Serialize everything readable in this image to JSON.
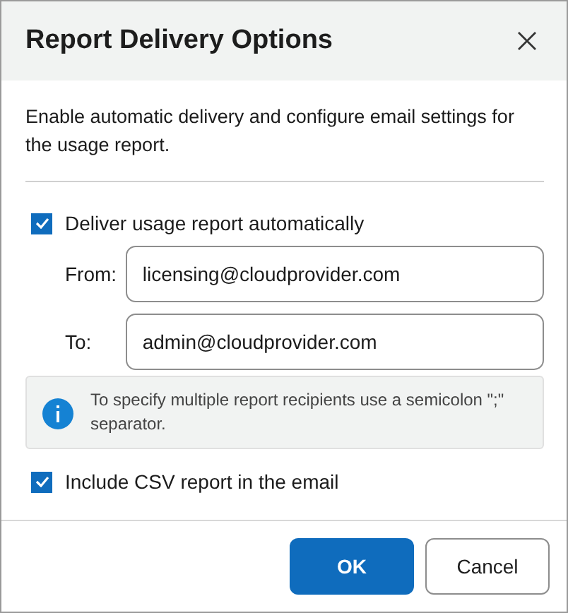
{
  "dialog": {
    "title": "Report Delivery Options"
  },
  "description": "Enable automatic delivery and configure email settings for the usage report.",
  "deliver_checkbox": {
    "label": "Deliver usage report automatically",
    "checked": true
  },
  "fields": [
    {
      "label": "From:",
      "value": "licensing@cloudprovider.com"
    },
    {
      "label": "To:",
      "value": "admin@cloudprovider.com"
    }
  ],
  "info": {
    "text": "To specify multiple report recipients use a semicolon \";\" separator."
  },
  "csv_checkbox": {
    "label": "Include CSV report in the email",
    "checked": true
  },
  "buttons": [
    {
      "label": "OK",
      "kind": "primary"
    },
    {
      "label": "Cancel",
      "kind": "secondary"
    }
  ]
}
